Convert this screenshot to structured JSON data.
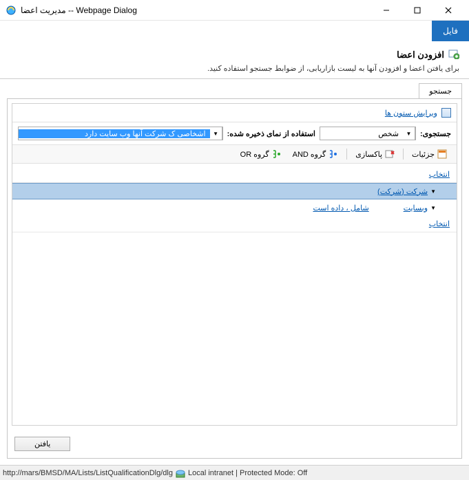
{
  "window": {
    "title": "مدیریت اعضا -- Webpage Dialog"
  },
  "menubar": {
    "file": "فایل"
  },
  "header": {
    "title": "افزودن اعضا",
    "desc": "برای یافتن اعضا و افزودن آنها به لیست بازاریابی، از ضوابط جستجو استفاده کنید."
  },
  "tabs": {
    "search": "جستجو"
  },
  "panel": {
    "edit_columns": "ویرایش ستون ها",
    "search_label": "جستجوی:",
    "search_value": "شخص",
    "view_label": "استفاده از نمای ذخیره شده:",
    "view_value": "اشخاصی ک شرکت آنها وب سایت دارد"
  },
  "toolbar": {
    "details": "جزئیات",
    "clear": "پاکسازی",
    "group_and": "گروه AND",
    "group_or": "گروه OR"
  },
  "criteria": {
    "select": "انتخاب",
    "entity": "شرکت (شرکت)",
    "field": "وبسایت",
    "operator": "شامل ، داده است"
  },
  "footer": {
    "find": "یافتن"
  },
  "status": {
    "url": "http://mars/BMSD/MA/Lists/ListQualificationDlg/dlg",
    "zone": "Local intranet | Protected Mode: Off"
  }
}
